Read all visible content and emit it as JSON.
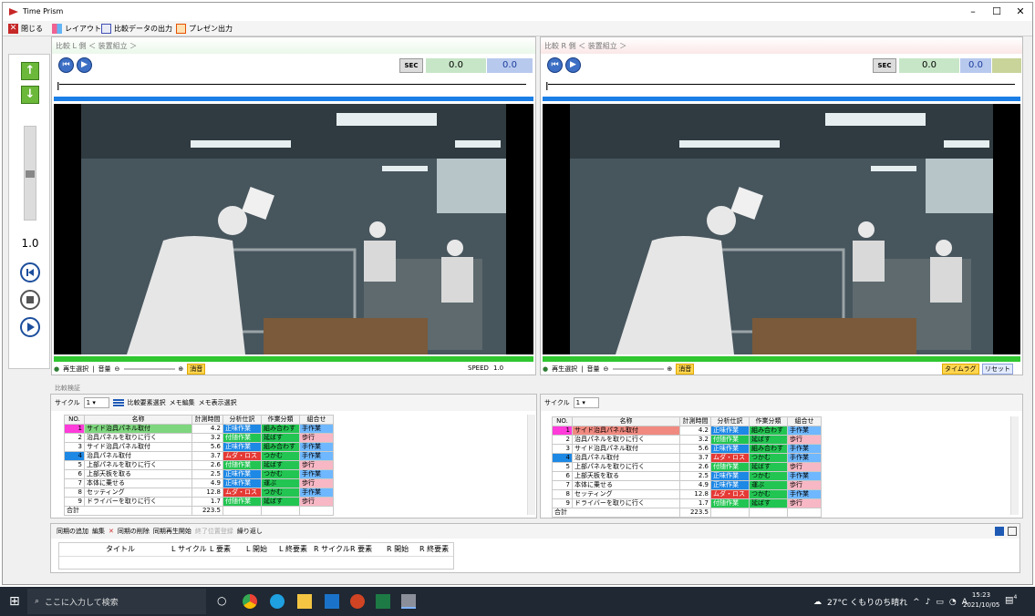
{
  "window": {
    "title": "Time Prism"
  },
  "toolbar": {
    "close": "閉じる",
    "layout": "レイアウト",
    "export_compare": "比較データの出力",
    "export_presentation": "プレゼン出力"
  },
  "left_controls": {
    "speed_value": "1.0"
  },
  "left_panel": {
    "header": "比較 L 側 ＜ 装置組立 ＞",
    "sec_label": "SEC",
    "time1": "0.0",
    "time2": "0.0",
    "footer": {
      "play_select": "再生選択",
      "volume": "音量",
      "mute": "消音",
      "speed": "SPEED",
      "speed_value": "1.0"
    }
  },
  "right_panel": {
    "header": "比較 R 側 ＜ 装置組立 ＞",
    "sec_label": "SEC",
    "time1": "0.0",
    "time2": "0.0",
    "footer": {
      "play_select": "再生選択",
      "volume": "音量",
      "mute": "消音",
      "timelag": "タイムラグ",
      "reset": "リセット"
    }
  },
  "compare_section": {
    "label": "比較検証"
  },
  "left_table": {
    "toolbar": {
      "cycle_label": "サイクル",
      "cycle_value": "1",
      "select_element": "比較要素選択",
      "memo_edit": "メモ編集",
      "memo_display": "メモ表示選択"
    },
    "columns": [
      "NO.",
      "名称",
      "計測時間",
      "分析仕訳",
      "作業分類",
      "組合せ"
    ],
    "rows": [
      {
        "no": "1",
        "name": "サイド治具パネル取付",
        "time": "4.2",
        "analysis": "正味作業",
        "cls": "組み合わす",
        "combo": "手作業"
      },
      {
        "no": "2",
        "name": "治具パネルを取りに行く",
        "time": "3.2",
        "analysis": "付随作業",
        "cls": "延ばす",
        "combo": "歩行"
      },
      {
        "no": "3",
        "name": "サイド治具パネル取付",
        "time": "5.6",
        "analysis": "正味作業",
        "cls": "組み合わす",
        "combo": "手作業"
      },
      {
        "no": "4",
        "name": "治具パネル取付",
        "time": "3.7",
        "analysis": "ムダ・ロス",
        "cls": "つかむ",
        "combo": "手作業"
      },
      {
        "no": "5",
        "name": "上部パネルを取りに行く",
        "time": "2.6",
        "analysis": "付随作業",
        "cls": "延ばす",
        "combo": "歩行"
      },
      {
        "no": "6",
        "name": "上部天板を取る",
        "time": "2.5",
        "analysis": "正味作業",
        "cls": "つかむ",
        "combo": "手作業"
      },
      {
        "no": "7",
        "name": "本体に乗せる",
        "time": "4.9",
        "analysis": "正味作業",
        "cls": "運ぶ",
        "combo": "歩行"
      },
      {
        "no": "8",
        "name": "セッティング",
        "time": "12.8",
        "analysis": "ムダ・ロス",
        "cls": "つかむ",
        "combo": "手作業"
      },
      {
        "no": "9",
        "name": "ドライバーを取りに行く",
        "time": "1.7",
        "analysis": "付随作業",
        "cls": "延ばす",
        "combo": "歩行"
      }
    ],
    "total_label": "合計",
    "total_value": "223.5"
  },
  "right_table": {
    "toolbar": {
      "cycle_label": "サイクル",
      "cycle_value": "1"
    },
    "columns": [
      "NO.",
      "名称",
      "計測時間",
      "分析仕訳",
      "作業分類",
      "組合せ"
    ],
    "rows": [
      {
        "no": "1",
        "name": "サイド治具パネル取付",
        "time": "4.2",
        "analysis": "正味作業",
        "cls": "組み合わす",
        "combo": "手作業"
      },
      {
        "no": "2",
        "name": "治具パネルを取りに行く",
        "time": "3.2",
        "analysis": "付随作業",
        "cls": "延ばす",
        "combo": "歩行"
      },
      {
        "no": "3",
        "name": "サイド治具パネル取付",
        "time": "5.6",
        "analysis": "正味作業",
        "cls": "組み合わす",
        "combo": "手作業"
      },
      {
        "no": "4",
        "name": "治具パネル取付",
        "time": "3.7",
        "analysis": "ムダ・ロス",
        "cls": "つかむ",
        "combo": "手作業"
      },
      {
        "no": "5",
        "name": "上部パネルを取りに行く",
        "time": "2.6",
        "analysis": "付随作業",
        "cls": "延ばす",
        "combo": "歩行"
      },
      {
        "no": "6",
        "name": "上部天板を取る",
        "time": "2.5",
        "analysis": "正味作業",
        "cls": "つかむ",
        "combo": "手作業"
      },
      {
        "no": "7",
        "name": "本体に乗せる",
        "time": "4.9",
        "analysis": "正味作業",
        "cls": "運ぶ",
        "combo": "歩行"
      },
      {
        "no": "8",
        "name": "セッティング",
        "time": "12.8",
        "analysis": "ムダ・ロス",
        "cls": "つかむ",
        "combo": "手作業"
      },
      {
        "no": "9",
        "name": "ドライバーを取りに行く",
        "time": "1.7",
        "analysis": "付随作業",
        "cls": "延ばす",
        "combo": "歩行"
      }
    ],
    "total_label": "合計",
    "total_value": "223.5"
  },
  "sync_panel": {
    "toolbar": {
      "add": "同期の追加",
      "edit": "編集",
      "delete": "同期の削除",
      "play_start": "同期再生開始",
      "register_end": "終了位置登録",
      "repeat": "繰り返し"
    },
    "columns": [
      "タイトル",
      "L サイクル",
      "L 要素",
      "L 開始",
      "L 終要素",
      "R サイクル",
      "R 要素",
      "R 開始",
      "R 終要素"
    ]
  },
  "taskbar": {
    "search_placeholder": "ここに入力して検索",
    "weather": "27°C くもりのち晴れ",
    "ime": "A",
    "time": "15:23",
    "date": "2021/10/05",
    "notification_count": "4"
  },
  "colors": {
    "net_work": "#1e88e5",
    "incidental": "#23c552",
    "waste": "#e53935",
    "row1_name": "#7ed67e",
    "row1_marker": "#ff3bd9",
    "row4_marker": "#1e88e5",
    "right_row1_name": "#f08a80"
  }
}
